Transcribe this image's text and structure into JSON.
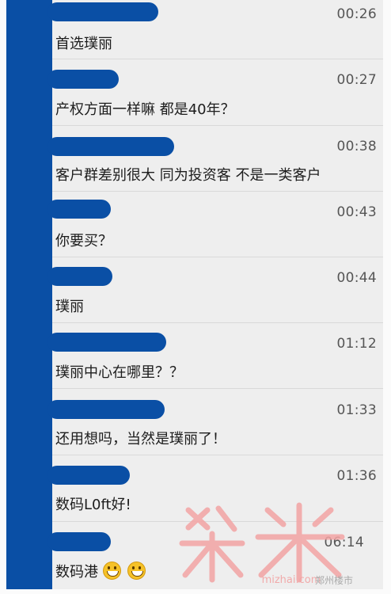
{
  "messages": [
    {
      "time": "00:26",
      "text": "首选璞丽"
    },
    {
      "time": "00:27",
      "text": "产权方面一样嘛 都是40年？"
    },
    {
      "time": "00:38",
      "text": "客户群差别很大 同为投资客 不是一类客户"
    },
    {
      "time": "00:43",
      "text": "你要买？"
    },
    {
      "time": "00:44",
      "text": "璞丽"
    },
    {
      "time": "01:12",
      "text": "璞丽中心在哪里？？"
    },
    {
      "time": "01:33",
      "text": "还用想吗，当然是璞丽了！"
    },
    {
      "time": "01:36",
      "text": "数码L0ft好!"
    },
    {
      "time": "06:14",
      "text": "数码港"
    }
  ],
  "watermark": {
    "brand": "米宅",
    "caption": "郑州楼市"
  },
  "colors": {
    "redaction": "#0a4fa5",
    "watermark": "#f2a3a3"
  }
}
